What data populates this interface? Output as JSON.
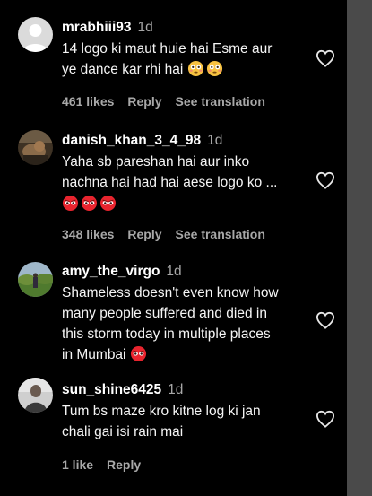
{
  "comments": [
    {
      "username": "mrabhiii93",
      "time": "1d",
      "text_line1": "14 logo ki maut huie hai Esme aur",
      "text_line2": "ye dance kar rhi hai",
      "emoji": [
        "flushed-face",
        "flushed-face"
      ],
      "likes": "461 likes",
      "reply": "Reply",
      "translate": "See translation"
    },
    {
      "username": "danish_khan_3_4_98",
      "time": "1d",
      "text_line1": "Yaha sb pareshan hai aur inko",
      "text_line2": "nachna hai had hai aese logo ko ...",
      "emoji": [
        "angry-eyes-face",
        "angry-eyes-face",
        "angry-eyes-face"
      ],
      "likes": "348 likes",
      "reply": "Reply",
      "translate": "See translation"
    },
    {
      "username": "amy_the_virgo",
      "time": "1d",
      "text_line1": "Shameless doesn't even know how",
      "text_line2": "many people suffered and died in",
      "text_line3": "this storm today in multiple places",
      "text_line4": "in Mumbai",
      "emoji": [
        "angry-eyes-face"
      ]
    },
    {
      "username": "sun_shine6425",
      "time": "1d",
      "text_line1": "Tum bs maze kro kitne log ki jan",
      "text_line2": "chali gai isi rain mai",
      "likes": "1 like",
      "reply": "Reply"
    }
  ],
  "colors": {
    "background": "#000000",
    "username": "#ffffff",
    "meta": "#a8a8a8",
    "scrollbar": "#4a4a4a"
  }
}
